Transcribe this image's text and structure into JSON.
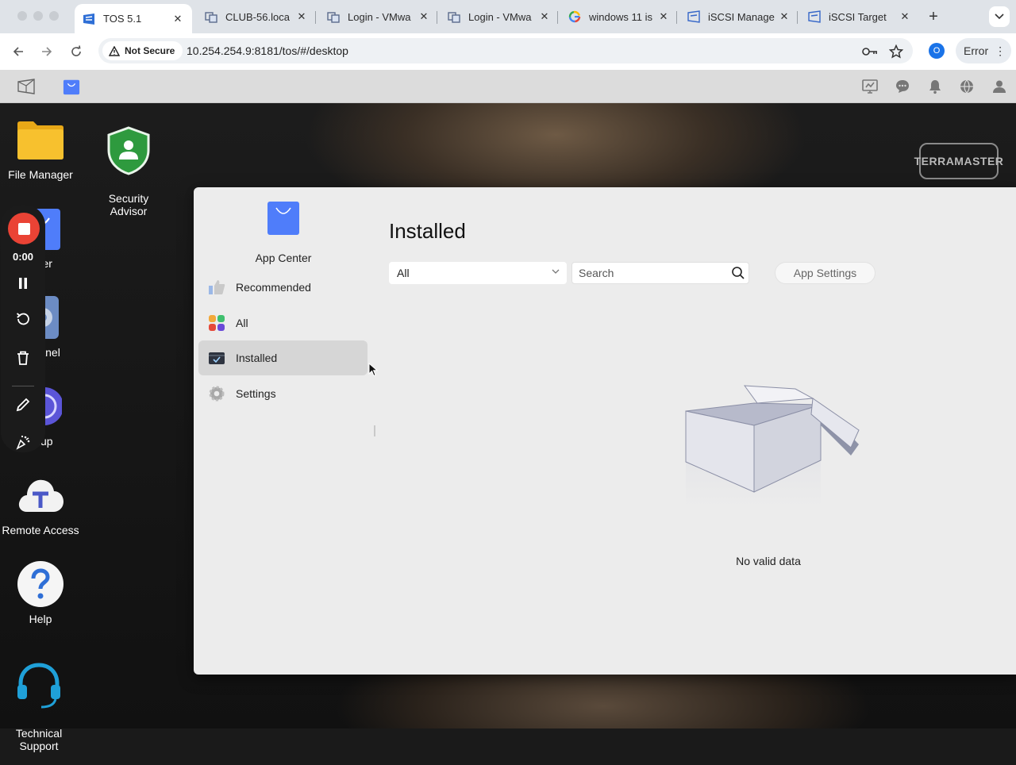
{
  "browser": {
    "tabs": [
      {
        "title": "TOS 5.1",
        "icon": "tos-icon",
        "active": true
      },
      {
        "title": "CLUB-56.loca",
        "icon": "vmware-icon"
      },
      {
        "title": "Login - VMwa",
        "icon": "vmware-icon"
      },
      {
        "title": "Login - VMwa",
        "icon": "vmware-icon"
      },
      {
        "title": "windows 11 is",
        "icon": "google-icon"
      },
      {
        "title": "iSCSI Manage",
        "icon": "iscsi-icon"
      },
      {
        "title": "iSCSI Target",
        "icon": "iscsi-icon"
      }
    ],
    "new_tab": "+",
    "security_label": "Not Secure",
    "url": "10.254.254.9:8181/tos/#/desktop",
    "profile_initial": "O",
    "error_label": "Error",
    "error_menu": "⋮"
  },
  "desktop": {
    "icons": [
      {
        "label": "File Manager"
      },
      {
        "label": "Security\nAdvisor"
      },
      {
        "label": "enter"
      },
      {
        "label": "Panel"
      },
      {
        "label": "kup"
      },
      {
        "label": "Remote Access"
      },
      {
        "label": "Help"
      },
      {
        "label": "Technical\nSupport"
      }
    ],
    "brand": "TERRAMASTER"
  },
  "recorder": {
    "time": "0:00"
  },
  "app_center": {
    "title": "App Center",
    "nav": [
      {
        "label": "Recommended"
      },
      {
        "label": "All"
      },
      {
        "label": "Installed",
        "active": true
      },
      {
        "label": "Settings"
      }
    ],
    "page_title": "Installed",
    "filter_value": "All",
    "search_placeholder": "Search",
    "app_settings_label": "App Settings",
    "empty_text": "No valid data"
  },
  "colors": {
    "accent_blue": "#4f7dfa",
    "record_red": "#ea4335",
    "shield_green": "#2e9a3e",
    "folder_yellow": "#f7c12e"
  }
}
